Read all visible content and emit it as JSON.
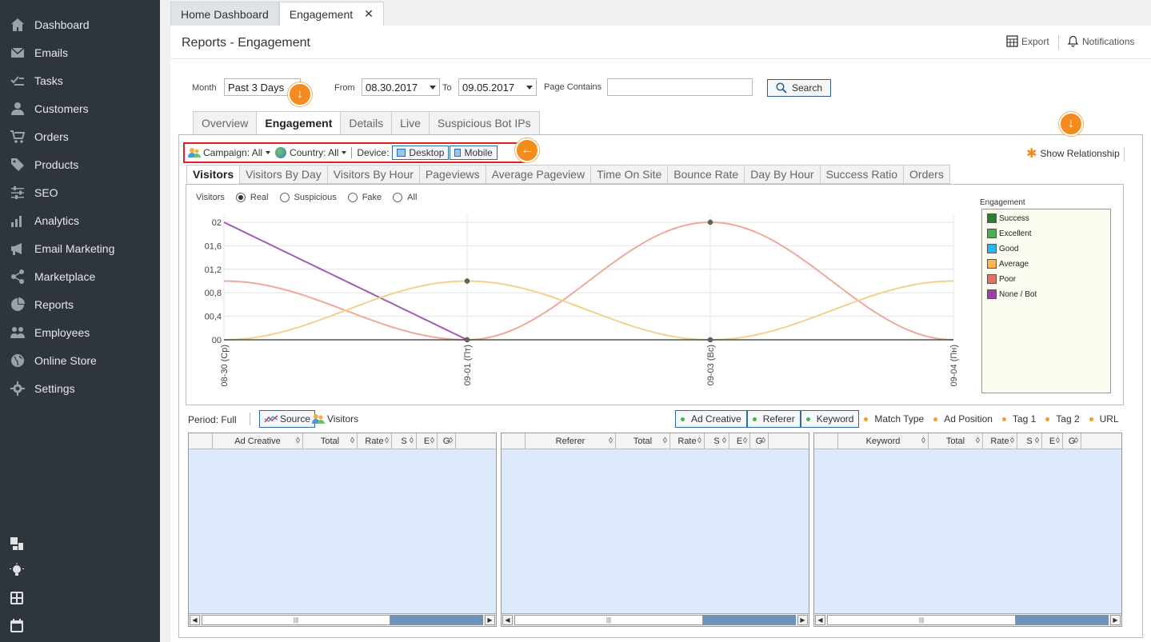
{
  "sidebar": {
    "items": [
      {
        "label": "Dashboard",
        "icon": "home-icon"
      },
      {
        "label": "Emails",
        "icon": "envelope-icon"
      },
      {
        "label": "Tasks",
        "icon": "tasks-icon"
      },
      {
        "label": "Customers",
        "icon": "user-icon"
      },
      {
        "label": "Orders",
        "icon": "cart-icon"
      },
      {
        "label": "Products",
        "icon": "tag-icon"
      },
      {
        "label": "SEO",
        "icon": "sliders-icon"
      },
      {
        "label": "Analytics",
        "icon": "bar-chart-icon"
      },
      {
        "label": "Email Marketing",
        "icon": "megaphone-icon"
      },
      {
        "label": "Marketplace",
        "icon": "share-icon"
      },
      {
        "label": "Reports",
        "icon": "pie-chart-icon"
      },
      {
        "label": "Employees",
        "icon": "users-icon"
      },
      {
        "label": "Online Store",
        "icon": "globe-icon"
      },
      {
        "label": "Settings",
        "icon": "gear-icon"
      }
    ]
  },
  "top_tabs": {
    "home": "Home Dashboard",
    "engagement": "Engagement"
  },
  "header": {
    "title": "Reports - Engagement",
    "export": "Export",
    "notifications": "Notifications"
  },
  "filters": {
    "month_label": "Month",
    "month_value": "Past 3 Days",
    "from_label": "From",
    "from_value": "08.30.2017",
    "to_label": "To",
    "to_value": "09.05.2017",
    "page_contains_label": "Page Contains",
    "page_contains_value": "",
    "search_label": "Search"
  },
  "sub_tabs": [
    "Overview",
    "Engagement",
    "Details",
    "Live",
    "Suspicious Bot IPs"
  ],
  "toolbar": {
    "campaign": "Campaign: All",
    "country": "Country: All",
    "device_label": "Device:",
    "desktop": "Desktop",
    "mobile": "Mobile",
    "show_relationship": "Show Relationship"
  },
  "chart_tabs": [
    "Visitors",
    "Visitors By Day",
    "Visitors By Hour",
    "Pageviews",
    "Average Pageview",
    "Time On Site",
    "Bounce Rate",
    "Day By Hour",
    "Success Ratio",
    "Orders"
  ],
  "visitor_filter": {
    "label": "Visitors",
    "options": [
      "Real",
      "Suspicious",
      "Fake",
      "All"
    ],
    "selected": "Real"
  },
  "legend": {
    "title": "Engagement",
    "items": [
      {
        "label": "Success",
        "color": "#2e7d32"
      },
      {
        "label": "Excellent",
        "color": "#4caf50"
      },
      {
        "label": "Good",
        "color": "#29b6f6"
      },
      {
        "label": "Average",
        "color": "#ffb74d"
      },
      {
        "label": "Poor",
        "color": "#e57360"
      },
      {
        "label": "None / Bot",
        "color": "#9c3fa8"
      }
    ]
  },
  "chart_data": {
    "type": "line",
    "x": [
      "08-30 (Ср)",
      "09-01 (Пт)",
      "09-03 (Вс)",
      "09-04 (Пн)"
    ],
    "y_ticks": [
      "00",
      "00,4",
      "00,8",
      "01,2",
      "01,6",
      "02"
    ],
    "ylim": [
      0,
      2
    ],
    "series": [
      {
        "name": "None / Bot",
        "color": "#a05cb3",
        "values": [
          2,
          0,
          null,
          null
        ]
      },
      {
        "name": "Poor",
        "color": "#eeaa99",
        "values": [
          1,
          0,
          2,
          0
        ]
      },
      {
        "name": "Average",
        "color": "#f5d08c",
        "values": [
          0,
          1,
          0,
          1
        ]
      },
      {
        "name": "Success",
        "color": "#333333",
        "values": [
          0,
          0,
          0,
          0
        ]
      }
    ]
  },
  "bottom": {
    "period": "Period: Full",
    "source": "Source",
    "visitors": "Visitors",
    "chips": [
      {
        "label": "Ad Creative",
        "color": "#4caf50",
        "boxed": true
      },
      {
        "label": "Referer",
        "color": "#4caf50",
        "boxed": true
      },
      {
        "label": "Keyword",
        "color": "#4caf50",
        "boxed": true
      },
      {
        "label": "Match Type",
        "color": "#f0a030",
        "boxed": false
      },
      {
        "label": "Ad Position",
        "color": "#f0a030",
        "boxed": false
      },
      {
        "label": "Tag 1",
        "color": "#f0a030",
        "boxed": false
      },
      {
        "label": "Tag 2",
        "color": "#f0a030",
        "boxed": false
      },
      {
        "label": "URL",
        "color": "#f0a030",
        "boxed": false
      }
    ],
    "grids": [
      {
        "columns": [
          "",
          "Ad Creative",
          "Total",
          "Rate",
          "S",
          "E",
          "G"
        ]
      },
      {
        "columns": [
          "",
          "Referer",
          "Total",
          "Rate",
          "S",
          "E",
          "G"
        ]
      },
      {
        "columns": [
          "",
          "Keyword",
          "Total",
          "Rate",
          "S",
          "E",
          "G"
        ]
      }
    ]
  }
}
